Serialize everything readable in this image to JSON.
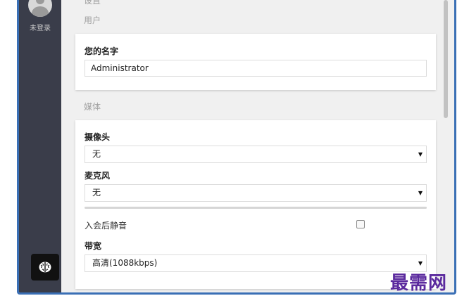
{
  "sidebar": {
    "login_status": "未登录",
    "avatar_icon": "user-avatar-icon",
    "brain_icon": "brain-icon"
  },
  "sections": {
    "settings_partial": "设置",
    "user": "用户",
    "media": "媒体"
  },
  "user_card": {
    "name_label": "您的名字",
    "name_value": "Administrator"
  },
  "media_card": {
    "camera_label": "摄像头",
    "camera_value": "无",
    "mic_label": "麦克风",
    "mic_value": "无",
    "mute_label": "入会后静音",
    "mute_checked": false,
    "bandwidth_label": "带宽",
    "bandwidth_value": "高清(1088kbps)"
  },
  "watermark": "最需网",
  "colors": {
    "sidebar": "#3a3d4a",
    "frame_border": "#3a6fb5",
    "watermark": "#5b2a9e"
  }
}
